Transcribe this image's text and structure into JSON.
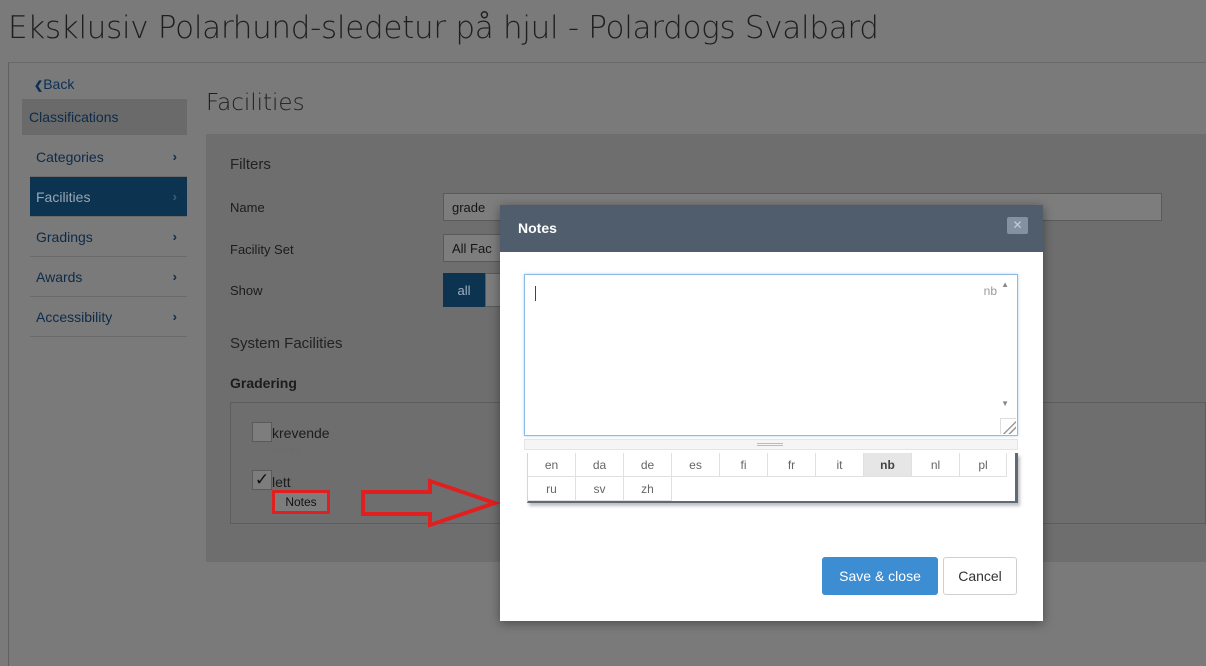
{
  "page": {
    "title": "Eksklusiv Polarhund-sledetur på hjul - Polardogs Svalbard"
  },
  "sidebar": {
    "back_label": "Back",
    "back_icon": "chevron-left-icon",
    "heading": "Classifications",
    "items": [
      {
        "label": "Categories",
        "active": false
      },
      {
        "label": "Facilities",
        "active": true
      },
      {
        "label": "Gradings",
        "active": false
      },
      {
        "label": "Awards",
        "active": false
      },
      {
        "label": "Accessibility",
        "active": false
      }
    ]
  },
  "main": {
    "title": "Facilities",
    "filters": {
      "heading": "Filters",
      "name_label": "Name",
      "name_value": "grade",
      "facility_set_label": "Facility Set",
      "facility_set_value": "All Fac",
      "show_label": "Show",
      "show_all": "all"
    },
    "system_facilities": {
      "heading": "System Facilities",
      "group": "Gradering",
      "items": [
        {
          "name": "krevende",
          "checked": false,
          "notes_label": "Notes"
        },
        {
          "name": "lett",
          "checked": true,
          "notes_label": "Notes",
          "check_glyph": "✓"
        }
      ]
    }
  },
  "modal": {
    "title": "Notes",
    "close_glyph": "✕",
    "current_language": "nb",
    "languages_row1": [
      "en",
      "da",
      "de",
      "es",
      "fi",
      "fr",
      "it",
      "nb",
      "nl",
      "pl"
    ],
    "languages_row2": [
      "ru",
      "sv",
      "zh"
    ],
    "save_label": "Save & close",
    "cancel_label": "Cancel",
    "colors": {
      "header": "#4f5d6c",
      "save": "#3c8dd2"
    }
  },
  "annotation": {
    "highlight_color": "#e02020"
  }
}
